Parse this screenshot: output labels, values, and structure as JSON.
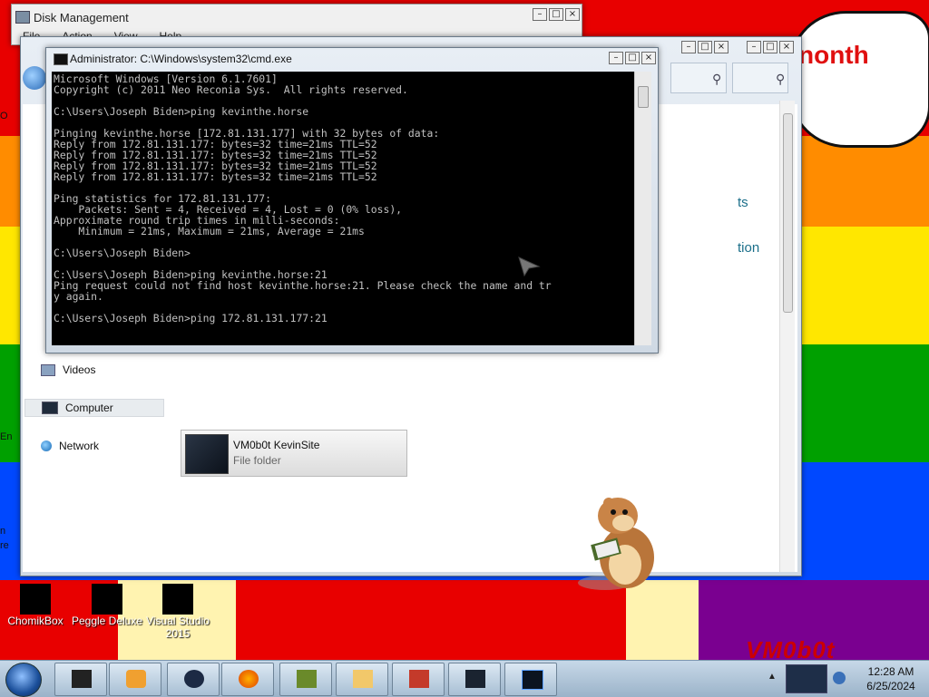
{
  "colors": {
    "rainbow": [
      "#e80000",
      "#ff8c00",
      "#ffe700",
      "#00a000",
      "#0048ff",
      "#7a0090"
    ],
    "console_bg": "#000000",
    "console_fg": "#c0c0c0",
    "link_teal": "#1b6f8a"
  },
  "wallpaper": {
    "bubble_text": "nonth",
    "left_fragments": [
      "O",
      "En",
      "n",
      "re"
    ],
    "logo_text": "VM0b0t"
  },
  "disk_management": {
    "title": "Disk Management",
    "menu": [
      "File",
      "Action",
      "View",
      "Help"
    ]
  },
  "explorer": {
    "nav": {
      "videos": "Videos",
      "computer": "Computer",
      "network": "Network"
    },
    "folder": {
      "name": "VM0b0t KevinSite",
      "type": "File folder"
    },
    "right_links": [
      "ts",
      "tion"
    ],
    "icons": [
      "search-icon",
      "search-icon"
    ]
  },
  "cmd": {
    "title": "Administrator: C:\\Windows\\system32\\cmd.exe",
    "lines": [
      "Microsoft Windows [Version 6.1.7601]",
      "Copyright (c) 2011 Neo Reconia Sys.  All rights reserved.",
      "",
      "C:\\Users\\Joseph Biden>ping kevinthe.horse",
      "",
      "Pinging kevinthe.horse [172.81.131.177] with 32 bytes of data:",
      "Reply from 172.81.131.177: bytes=32 time=21ms TTL=52",
      "Reply from 172.81.131.177: bytes=32 time=21ms TTL=52",
      "Reply from 172.81.131.177: bytes=32 time=21ms TTL=52",
      "Reply from 172.81.131.177: bytes=32 time=21ms TTL=52",
      "",
      "Ping statistics for 172.81.131.177:",
      "    Packets: Sent = 4, Received = 4, Lost = 0 (0% loss),",
      "Approximate round trip times in milli-seconds:",
      "    Minimum = 21ms, Maximum = 21ms, Average = 21ms",
      "",
      "C:\\Users\\Joseph Biden>",
      "",
      "C:\\Users\\Joseph Biden>ping kevinthe.horse:21",
      "Ping request could not find host kevinthe.horse:21. Please check the name and tr",
      "y again.",
      "",
      "C:\\Users\\Joseph Biden>ping 172.81.131.177:21"
    ]
  },
  "desktop_icons": [
    {
      "label": "ChomikBox"
    },
    {
      "label": "Peggle Deluxe"
    },
    {
      "label": "Visual Studio 2015"
    }
  ],
  "taskbar": {
    "items": [
      "explorer",
      "media-player",
      "chrome-dark",
      "firefox",
      "chomikbox",
      "folder",
      "toolbox",
      "vm-window",
      "cmd-window"
    ],
    "time": "12:28 AM",
    "date": "6/25/2024"
  }
}
